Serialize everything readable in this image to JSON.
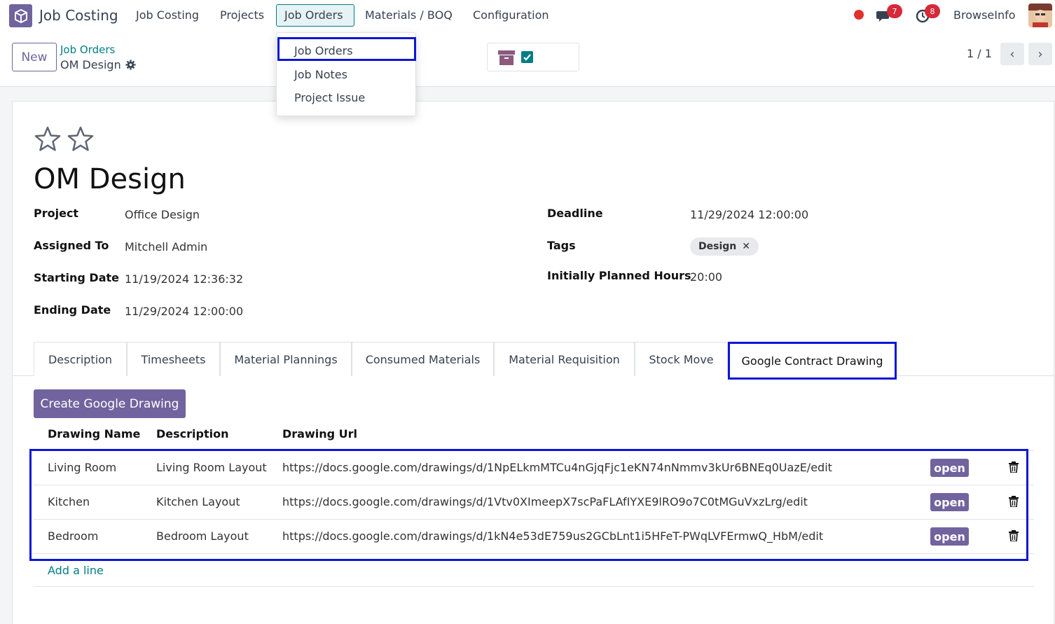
{
  "navbar": {
    "app_name": "Job Costing",
    "menu": [
      "Job Costing",
      "Projects",
      "Job Orders",
      "Materials / BOQ",
      "Configuration"
    ],
    "messages_count": "7",
    "activities_count": "8",
    "company": "BrowseInfo"
  },
  "control": {
    "new_label": "New",
    "breadcrumb_parent": "Job Orders",
    "breadcrumb_current": "OM Design",
    "pager": "1 / 1"
  },
  "dropdown": {
    "items": [
      "Job Orders",
      "Job Notes",
      "Project Issue"
    ]
  },
  "form": {
    "title": "OM Design",
    "project_label": "Project",
    "project": "Office Design",
    "assigned_label": "Assigned To",
    "assigned": "Mitchell Admin",
    "start_label": "Starting Date",
    "start": "11/19/2024 12:36:32",
    "end_label": "Ending Date",
    "end": "11/29/2024 12:00:00",
    "deadline_label": "Deadline",
    "deadline": "11/29/2024 12:00:00",
    "tags_label": "Tags",
    "tag": "Design",
    "hours_label": "Initially Planned Hours",
    "hours": "20:00"
  },
  "tabs": [
    "Description",
    "Timesheets",
    "Material Plannings",
    "Consumed Materials",
    "Material Requisition",
    "Stock Move",
    "Google Contract Drawing"
  ],
  "drawings": {
    "create_label": "Create Google Drawing",
    "columns": [
      "Drawing Name",
      "Description",
      "Drawing Url"
    ],
    "rows": [
      {
        "name": "Living Room",
        "description": "Living Room Layout",
        "url": "https://docs.google.com/drawings/d/1NpELkmMTCu4nGjqFjc1eKN74nNmmv3kUr6BNEq0UazE/edit",
        "action": "open"
      },
      {
        "name": "Kitchen",
        "description": "Kitchen Layout",
        "url": "https://docs.google.com/drawings/d/1Vtv0XImeepX7scPaFLAfIYXE9lRO9o7C0tMGuVxzLrg/edit",
        "action": "open"
      },
      {
        "name": "Bedroom",
        "description": "Bedroom Layout",
        "url": "https://docs.google.com/drawings/d/1kN4e53dE759us2GCbLnt1i5HFeT-PWqLVFErmwQ_HbM/edit",
        "action": "open"
      }
    ],
    "add_line": "Add a line"
  },
  "colors": {
    "primary": "#71639e",
    "link": "#017e84",
    "highlight": "#0a16d6",
    "badge": "#d6293a"
  }
}
